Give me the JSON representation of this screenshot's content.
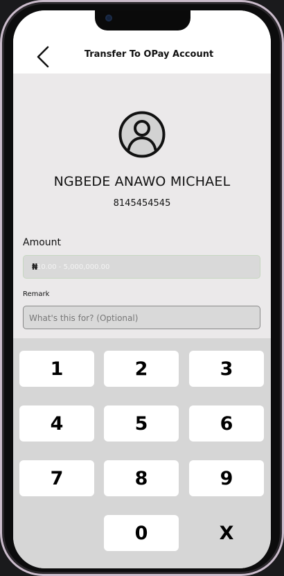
{
  "header": {
    "title": "Transfer To OPay Account",
    "back_icon": "chevron-left-icon"
  },
  "recipient": {
    "avatar_icon": "user-avatar-icon",
    "name": "NGBEDE ANAWO MICHAEL",
    "account_number": "8145454545"
  },
  "form": {
    "amount_label": "Amount",
    "currency_symbol": "₦",
    "amount_placeholder": "10.00 - 5,000,000.00",
    "amount_value": "",
    "remark_label": "Remark",
    "remark_placeholder": "What's this for? (Optional)",
    "remark_value": ""
  },
  "keypad": {
    "keys": [
      "1",
      "2",
      "3",
      "4",
      "5",
      "6",
      "7",
      "8",
      "9",
      "0",
      "X"
    ]
  },
  "colors": {
    "header_bg": "#ffffff",
    "screen_bg": "#ebe9ea",
    "keypad_bg": "#d6d6d6",
    "key_bg": "#ffffff",
    "field_bg": "#d9d9d9",
    "frame_accent": "#cbbccc"
  }
}
